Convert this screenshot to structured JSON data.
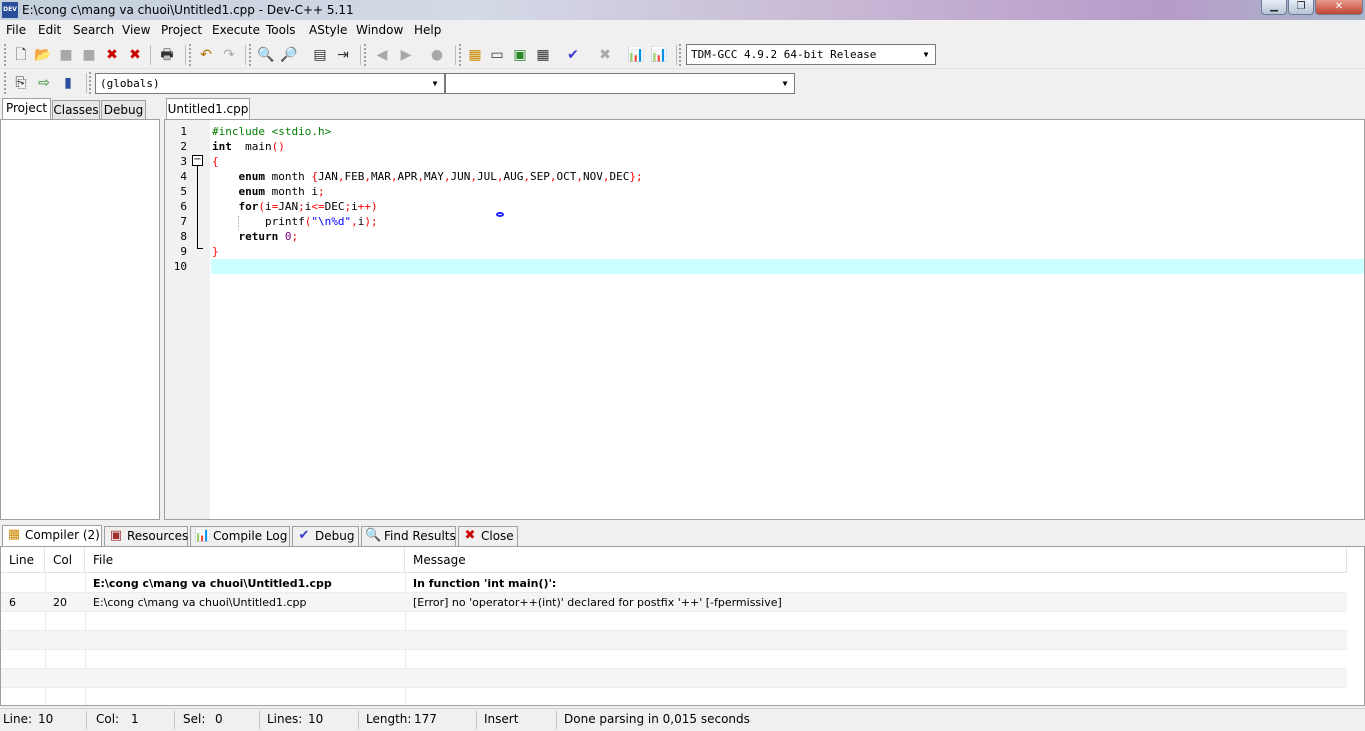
{
  "window": {
    "app_icon_text": "DEV",
    "title": "E:\\cong c\\mang va chuoi\\Untitled1.cpp - Dev-C++ 5.11",
    "minimize": "▁",
    "maximize": "❐",
    "close": "✕"
  },
  "menu": [
    "File",
    "Edit",
    "Search",
    "View",
    "Project",
    "Execute",
    "Tools",
    "AStyle",
    "Window",
    "Help"
  ],
  "toolbar": {
    "compiler_select": "TDM-GCC 4.9.2 64-bit Release",
    "scope_select": "(globals)",
    "function_select": ""
  },
  "left_tabs": [
    "Project",
    "Classes",
    "Debug"
  ],
  "editor": {
    "tab": "Untitled1.cpp",
    "line_numbers": [
      "1",
      "2",
      "3",
      "4",
      "5",
      "6",
      "7",
      "8",
      "9",
      "10"
    ]
  },
  "bottom_tabs": [
    "Compiler (2)",
    "Resources",
    "Compile Log",
    "Debug",
    "Find Results",
    "Close"
  ],
  "compiler": {
    "headers": [
      "Line",
      "Col",
      "File",
      "Message"
    ],
    "rows": [
      {
        "line": "",
        "col": "",
        "file": "E:\\cong c\\mang va chuoi\\Untitled1.cpp",
        "message": "In function 'int main()':"
      },
      {
        "line": "6",
        "col": "20",
        "file": "E:\\cong c\\mang va chuoi\\Untitled1.cpp",
        "message": "[Error] no 'operator++(int)' declared for postfix '++' [-fpermissive]"
      }
    ]
  },
  "status": {
    "line_label": "Line:",
    "line_value": "10",
    "col_label": "Col:",
    "col_value": "1",
    "sel_label": "Sel:",
    "sel_value": "0",
    "lines_label": "Lines:",
    "lines_value": "10",
    "length_label": "Length:",
    "length_value": "177",
    "mode": "Insert",
    "message": "Done parsing in 0,015 seconds"
  }
}
